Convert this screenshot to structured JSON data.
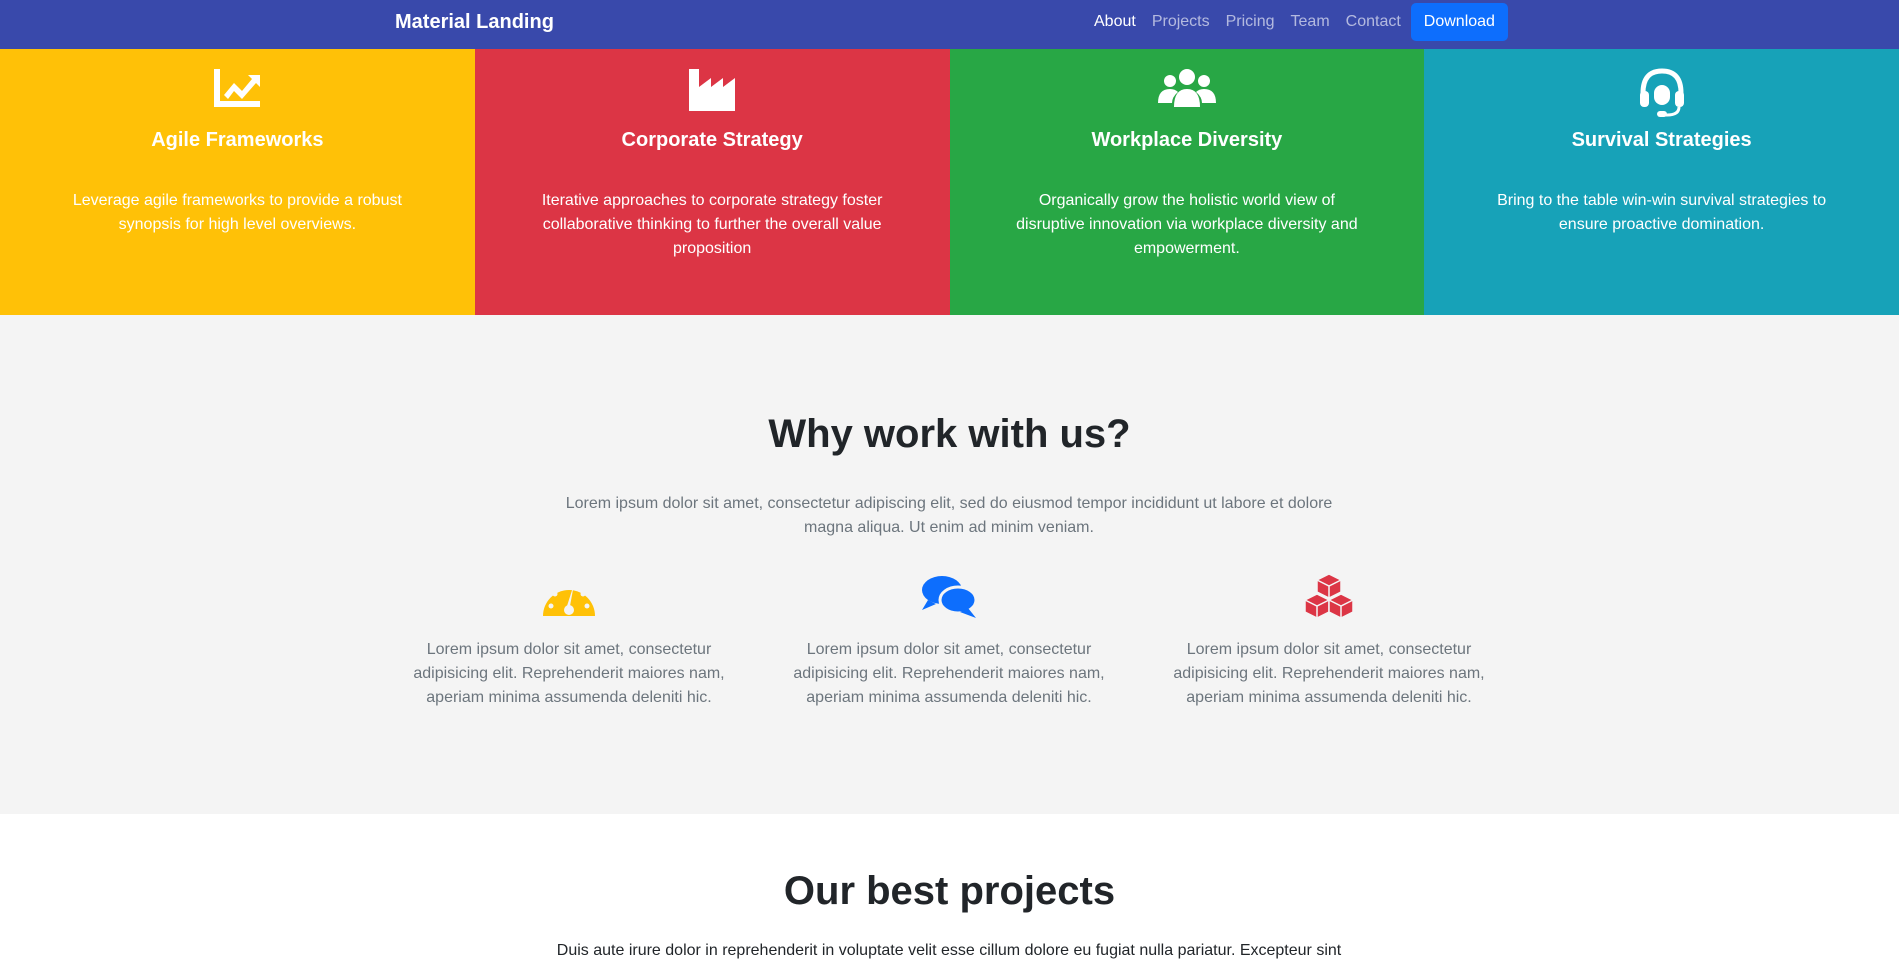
{
  "navbar": {
    "brand": "Material Landing",
    "links": [
      "About",
      "Projects",
      "Pricing",
      "Team",
      "Contact"
    ],
    "download_label": "Download",
    "background": "#3949ab"
  },
  "features": [
    {
      "title": "Agile Frameworks",
      "text": "Leverage agile frameworks to provide a robust synopsis for high level overviews.",
      "icon": "chart-line-icon",
      "color": "#ffc107"
    },
    {
      "title": "Corporate Strategy",
      "text": "Iterative approaches to corporate strategy foster collaborative thinking to further the overall value proposition",
      "icon": "industry-icon",
      "color": "#dc3545"
    },
    {
      "title": "Workplace Diversity",
      "text": "Organically grow the holistic world view of disruptive innovation via workplace diversity and empowerment.",
      "icon": "users-icon",
      "color": "#28a745"
    },
    {
      "title": "Survival Strategies",
      "text": "Bring to the table win-win survival strategies to ensure proactive domination.",
      "icon": "headset-icon",
      "color": "#17a2b8"
    }
  ],
  "why": {
    "title": "Why work with us?",
    "lead": "Lorem ipsum dolor sit amet, consectetur adipiscing elit, sed do eiusmod tempor incididunt ut labore et dolore magna aliqua. Ut enim ad minim veniam.",
    "items": [
      {
        "icon": "speedometer-icon",
        "color": "#ffc107",
        "text": "Lorem ipsum dolor sit amet, consectetur adipisicing elit. Reprehenderit maiores nam, aperiam minima assumenda deleniti hic."
      },
      {
        "icon": "chat-bubbles-icon",
        "color": "#0d6efd",
        "text": "Lorem ipsum dolor sit amet, consectetur adipisicing elit. Reprehenderit maiores nam, aperiam minima assumenda deleniti hic."
      },
      {
        "icon": "cubes-icon",
        "color": "#dc3545",
        "text": "Lorem ipsum dolor sit amet, consectetur adipisicing elit. Reprehenderit maiores nam, aperiam minima assumenda deleniti hic."
      }
    ]
  },
  "projects": {
    "title": "Our best projects",
    "lead": "Duis aute irure dolor in reprehenderit in voluptate velit esse cillum dolore eu fugiat nulla pariatur. Excepteur sint"
  }
}
